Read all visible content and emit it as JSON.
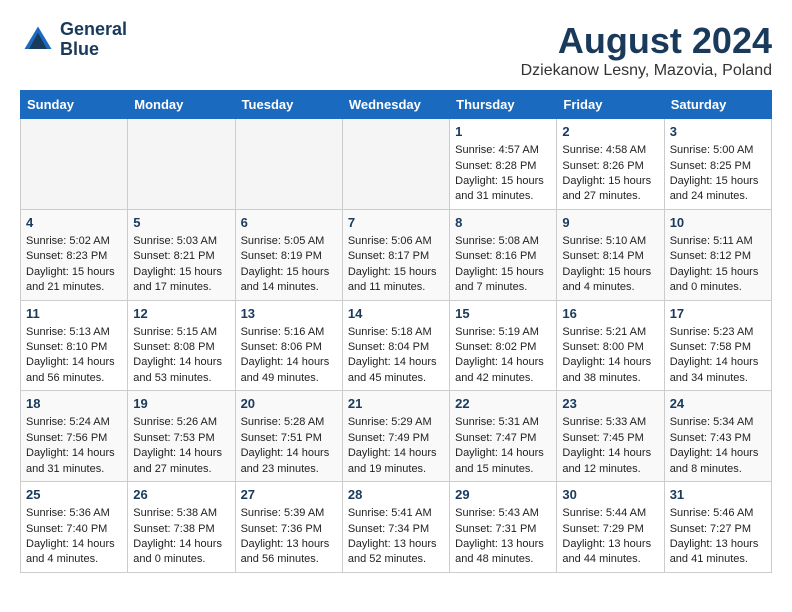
{
  "header": {
    "logo_line1": "General",
    "logo_line2": "Blue",
    "month_year": "August 2024",
    "location": "Dziekanow Lesny, Mazovia, Poland"
  },
  "days_of_week": [
    "Sunday",
    "Monday",
    "Tuesday",
    "Wednesday",
    "Thursday",
    "Friday",
    "Saturday"
  ],
  "weeks": [
    [
      {
        "day": "",
        "info": ""
      },
      {
        "day": "",
        "info": ""
      },
      {
        "day": "",
        "info": ""
      },
      {
        "day": "",
        "info": ""
      },
      {
        "day": "1",
        "info": "Sunrise: 4:57 AM\nSunset: 8:28 PM\nDaylight: 15 hours\nand 31 minutes."
      },
      {
        "day": "2",
        "info": "Sunrise: 4:58 AM\nSunset: 8:26 PM\nDaylight: 15 hours\nand 27 minutes."
      },
      {
        "day": "3",
        "info": "Sunrise: 5:00 AM\nSunset: 8:25 PM\nDaylight: 15 hours\nand 24 minutes."
      }
    ],
    [
      {
        "day": "4",
        "info": "Sunrise: 5:02 AM\nSunset: 8:23 PM\nDaylight: 15 hours\nand 21 minutes."
      },
      {
        "day": "5",
        "info": "Sunrise: 5:03 AM\nSunset: 8:21 PM\nDaylight: 15 hours\nand 17 minutes."
      },
      {
        "day": "6",
        "info": "Sunrise: 5:05 AM\nSunset: 8:19 PM\nDaylight: 15 hours\nand 14 minutes."
      },
      {
        "day": "7",
        "info": "Sunrise: 5:06 AM\nSunset: 8:17 PM\nDaylight: 15 hours\nand 11 minutes."
      },
      {
        "day": "8",
        "info": "Sunrise: 5:08 AM\nSunset: 8:16 PM\nDaylight: 15 hours\nand 7 minutes."
      },
      {
        "day": "9",
        "info": "Sunrise: 5:10 AM\nSunset: 8:14 PM\nDaylight: 15 hours\nand 4 minutes."
      },
      {
        "day": "10",
        "info": "Sunrise: 5:11 AM\nSunset: 8:12 PM\nDaylight: 15 hours\nand 0 minutes."
      }
    ],
    [
      {
        "day": "11",
        "info": "Sunrise: 5:13 AM\nSunset: 8:10 PM\nDaylight: 14 hours\nand 56 minutes."
      },
      {
        "day": "12",
        "info": "Sunrise: 5:15 AM\nSunset: 8:08 PM\nDaylight: 14 hours\nand 53 minutes."
      },
      {
        "day": "13",
        "info": "Sunrise: 5:16 AM\nSunset: 8:06 PM\nDaylight: 14 hours\nand 49 minutes."
      },
      {
        "day": "14",
        "info": "Sunrise: 5:18 AM\nSunset: 8:04 PM\nDaylight: 14 hours\nand 45 minutes."
      },
      {
        "day": "15",
        "info": "Sunrise: 5:19 AM\nSunset: 8:02 PM\nDaylight: 14 hours\nand 42 minutes."
      },
      {
        "day": "16",
        "info": "Sunrise: 5:21 AM\nSunset: 8:00 PM\nDaylight: 14 hours\nand 38 minutes."
      },
      {
        "day": "17",
        "info": "Sunrise: 5:23 AM\nSunset: 7:58 PM\nDaylight: 14 hours\nand 34 minutes."
      }
    ],
    [
      {
        "day": "18",
        "info": "Sunrise: 5:24 AM\nSunset: 7:56 PM\nDaylight: 14 hours\nand 31 minutes."
      },
      {
        "day": "19",
        "info": "Sunrise: 5:26 AM\nSunset: 7:53 PM\nDaylight: 14 hours\nand 27 minutes."
      },
      {
        "day": "20",
        "info": "Sunrise: 5:28 AM\nSunset: 7:51 PM\nDaylight: 14 hours\nand 23 minutes."
      },
      {
        "day": "21",
        "info": "Sunrise: 5:29 AM\nSunset: 7:49 PM\nDaylight: 14 hours\nand 19 minutes."
      },
      {
        "day": "22",
        "info": "Sunrise: 5:31 AM\nSunset: 7:47 PM\nDaylight: 14 hours\nand 15 minutes."
      },
      {
        "day": "23",
        "info": "Sunrise: 5:33 AM\nSunset: 7:45 PM\nDaylight: 14 hours\nand 12 minutes."
      },
      {
        "day": "24",
        "info": "Sunrise: 5:34 AM\nSunset: 7:43 PM\nDaylight: 14 hours\nand 8 minutes."
      }
    ],
    [
      {
        "day": "25",
        "info": "Sunrise: 5:36 AM\nSunset: 7:40 PM\nDaylight: 14 hours\nand 4 minutes."
      },
      {
        "day": "26",
        "info": "Sunrise: 5:38 AM\nSunset: 7:38 PM\nDaylight: 14 hours\nand 0 minutes."
      },
      {
        "day": "27",
        "info": "Sunrise: 5:39 AM\nSunset: 7:36 PM\nDaylight: 13 hours\nand 56 minutes."
      },
      {
        "day": "28",
        "info": "Sunrise: 5:41 AM\nSunset: 7:34 PM\nDaylight: 13 hours\nand 52 minutes."
      },
      {
        "day": "29",
        "info": "Sunrise: 5:43 AM\nSunset: 7:31 PM\nDaylight: 13 hours\nand 48 minutes."
      },
      {
        "day": "30",
        "info": "Sunrise: 5:44 AM\nSunset: 7:29 PM\nDaylight: 13 hours\nand 44 minutes."
      },
      {
        "day": "31",
        "info": "Sunrise: 5:46 AM\nSunset: 7:27 PM\nDaylight: 13 hours\nand 41 minutes."
      }
    ]
  ]
}
